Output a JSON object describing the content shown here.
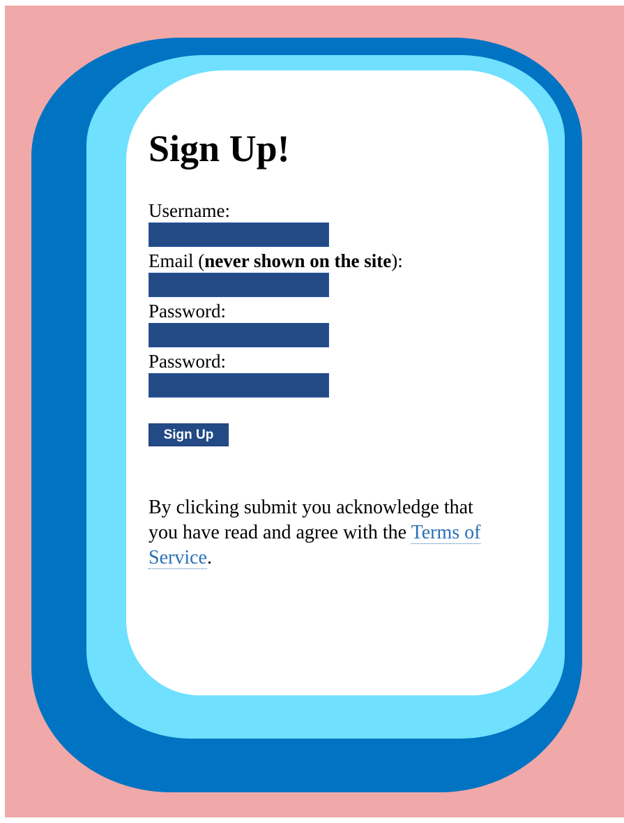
{
  "colors": {
    "page_background": "#f0a8a8",
    "outer_frame": "#0073c2",
    "middle_frame": "#6fe0fd",
    "card": "#ffffff",
    "input_fill": "#234a85",
    "link": "#2a6fb5"
  },
  "signup": {
    "title": "Sign Up!",
    "username_label": "Username:",
    "username_value": "",
    "email_label_prefix": "Email (",
    "email_label_bold": "never shown on the site",
    "email_label_suffix": "):",
    "email_value": "",
    "password_label": "Password:",
    "password_value": "",
    "password_confirm_label": "Password:",
    "password_confirm_value": "",
    "submit_label": "Sign Up",
    "notice_text": "By clicking submit you acknowledge that you have read and agree with the ",
    "tos_link": "Terms of Service",
    "notice_end": "."
  }
}
